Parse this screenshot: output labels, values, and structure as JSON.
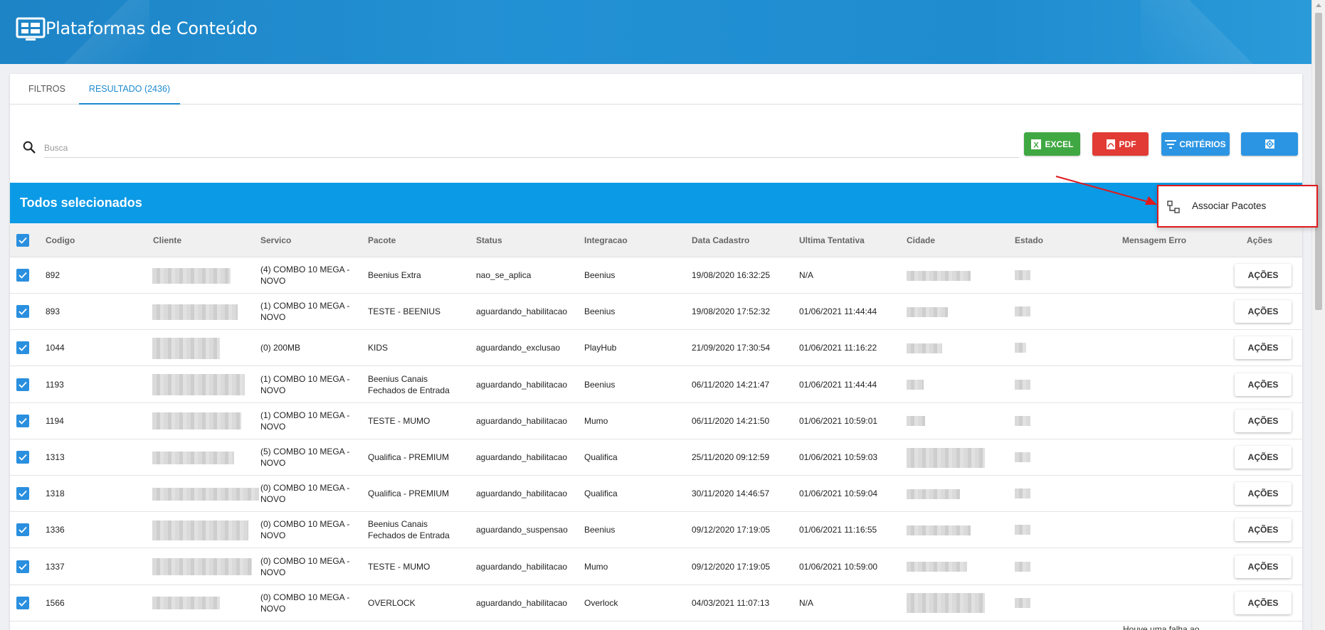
{
  "header": {
    "title": "Plataformas de Conteúdo"
  },
  "tabs": [
    {
      "label": "FILTROS"
    },
    {
      "label": "RESULTADO (2436)"
    }
  ],
  "search": {
    "placeholder": "Busca",
    "value": ""
  },
  "toolbar": {
    "excel_label": "EXCEL",
    "pdf_label": "PDF",
    "criterios_label": "CRITÉRIOS"
  },
  "selection": {
    "title": "Todos selecionados"
  },
  "menu": {
    "associar_label": "Associar Pacotes"
  },
  "colors": {
    "header": "#1d84c6",
    "selection_bar": "#0b9ae6",
    "excel": "#3fa842",
    "pdf": "#e23b35",
    "primary": "#2c95e3",
    "highlight": "#e0191d"
  },
  "table": {
    "columns": [
      "Codigo",
      "Cliente",
      "Servico",
      "Pacote",
      "Status",
      "Integracao",
      "Data Cadastro",
      "Ultima Tentativa",
      "Cidade",
      "Estado",
      "Mensagem Erro",
      "Ações"
    ],
    "action_label": "AÇÕES",
    "rows": [
      {
        "codigo": "892",
        "servico": "(4) COMBO 10 MEGA - NOVO",
        "pacote": "Beenius Extra",
        "status": "nao_se_aplica",
        "integracao": "Beenius",
        "data_cadastro": "19/08/2020 16:32:25",
        "ultima_tentativa": "N/A",
        "mensagem_erro": ""
      },
      {
        "codigo": "893",
        "servico": "(1) COMBO 10 MEGA - NOVO",
        "pacote": "TESTE - BEENIUS",
        "status": "aguardando_habilitacao",
        "integracao": "Beenius",
        "data_cadastro": "19/08/2020 17:52:32",
        "ultima_tentativa": "01/06/2021 11:44:44",
        "mensagem_erro": ""
      },
      {
        "codigo": "1044",
        "servico": "(0) 200MB",
        "pacote": "KIDS",
        "status": "aguardando_exclusao",
        "integracao": "PlayHub",
        "data_cadastro": "21/09/2020 17:30:54",
        "ultima_tentativa": "01/06/2021 11:16:22",
        "mensagem_erro": ""
      },
      {
        "codigo": "1193",
        "servico": "(1) COMBO 10 MEGA - NOVO",
        "pacote": "Beenius Canais Fechados de Entrada",
        "status": "aguardando_habilitacao",
        "integracao": "Beenius",
        "data_cadastro": "06/11/2020 14:21:47",
        "ultima_tentativa": "01/06/2021 11:44:44",
        "mensagem_erro": ""
      },
      {
        "codigo": "1194",
        "servico": "(1) COMBO 10 MEGA - NOVO",
        "pacote": "TESTE - MUMO",
        "status": "aguardando_habilitacao",
        "integracao": "Mumo",
        "data_cadastro": "06/11/2020 14:21:50",
        "ultima_tentativa": "01/06/2021 10:59:01",
        "mensagem_erro": ""
      },
      {
        "codigo": "1313",
        "servico": "(5) COMBO 10 MEGA - NOVO",
        "pacote": "Qualifica - PREMIUM",
        "status": "aguardando_habilitacao",
        "integracao": "Qualifica",
        "data_cadastro": "25/11/2020 09:12:59",
        "ultima_tentativa": "01/06/2021 10:59:03",
        "mensagem_erro": ""
      },
      {
        "codigo": "1318",
        "servico": "(0) COMBO 10 MEGA - NOVO",
        "pacote": "Qualifica - PREMIUM",
        "status": "aguardando_habilitacao",
        "integracao": "Qualifica",
        "data_cadastro": "30/11/2020 14:46:57",
        "ultima_tentativa": "01/06/2021 10:59:04",
        "mensagem_erro": ""
      },
      {
        "codigo": "1336",
        "servico": "(0) COMBO 10 MEGA - NOVO",
        "pacote": "Beenius Canais Fechados de Entrada",
        "status": "aguardando_suspensao",
        "integracao": "Beenius",
        "data_cadastro": "09/12/2020 17:19:05",
        "ultima_tentativa": "01/06/2021 11:16:55",
        "mensagem_erro": ""
      },
      {
        "codigo": "1337",
        "servico": "(0) COMBO 10 MEGA - NOVO",
        "pacote": "TESTE - MUMO",
        "status": "aguardando_habilitacao",
        "integracao": "Mumo",
        "data_cadastro": "09/12/2020 17:19:05",
        "ultima_tentativa": "01/06/2021 10:59:00",
        "mensagem_erro": ""
      },
      {
        "codigo": "1566",
        "servico": "(0) COMBO 10 MEGA - NOVO",
        "pacote": "OVERLOCK",
        "status": "aguardando_habilitacao",
        "integracao": "Overlock",
        "data_cadastro": "04/03/2021 11:07:13",
        "ultima_tentativa": "N/A",
        "mensagem_erro": ""
      }
    ],
    "partial_next_row_message": "Houve uma falha ao"
  }
}
